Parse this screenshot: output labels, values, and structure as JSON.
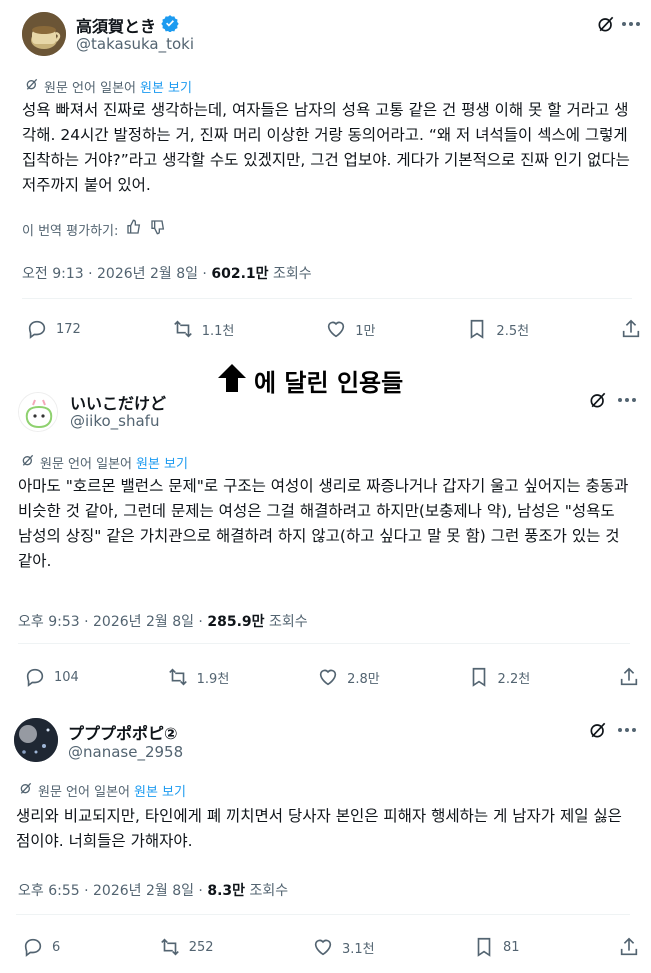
{
  "tweets": [
    {
      "name": "高須賀とき",
      "handle": "@takasuka_toki",
      "verified": true,
      "translation_note": "원문 언어 일본어",
      "show_original": "원본 보기",
      "text": "성욕 빠져서 진짜로 생각하는데, 여자들은 남자의 성욕 고통 같은 건 평생 이해 못 할 거라고 생각해. 24시간 발정하는 거, 진짜 머리 이상한 거랑 동의어라고. “왜 저 녀석들이 섹스에 그렇게 집착하는 거야?”라고 생각할 수도 있겠지만, 그건 업보야. 게다가 기본적으로 진짜 인기 없다는 저주까지 붙어 있어.",
      "rate_label": "이 번역 평가하기:",
      "time": "오전 9:13 · 2026년 2월 8일 ·",
      "views": "602.1만",
      "views_label": "조회수",
      "replies": "172",
      "retweets": "1.1천",
      "likes": "1만",
      "bookmarks": "2.5천"
    },
    {
      "name": "いいこだけど",
      "handle": "@iiko_shafu",
      "translation_note": "원문 언어 일본어",
      "show_original": "원본 보기",
      "text": "아마도 \"호르몬 밸런스 문제\"로 구조는 여성이 생리로 짜증나거나 갑자기 울고 싶어지는 충동과 비슷한 것 같아, 그런데 문제는 여성은 그걸 해결하려고 하지만(보충제나 약), 남성은 \"성욕도 남성의 상징\" 같은 가치관으로 해결하려 하지 않고(하고 싶다고 말 못 함) 그런 풍조가 있는 것 같아.",
      "time": "오후 9:53 · 2026년 2월 8일 ·",
      "views": "285.9만",
      "views_label": "조회수",
      "replies": "104",
      "retweets": "1.9천",
      "likes": "2.8만",
      "bookmarks": "2.2천"
    },
    {
      "name": "プププポポピ②",
      "handle": "@nanase_2958",
      "translation_note": "원문 언어 일본어",
      "show_original": "원본 보기",
      "text": "생리와 비교되지만, 타인에게 폐 끼치면서 당사자 본인은 피해자 행세하는 게 남자가 제일 싫은 점이야. 너희들은 가해자야.",
      "time": "오후 6:55 · 2026년 2월 8일 ·",
      "views": "8.3만",
      "views_label": "조회수",
      "replies": "6",
      "retweets": "252",
      "likes": "3.1천",
      "bookmarks": "81"
    }
  ],
  "quotes_banner": "에 달린 인용들",
  "colors": {
    "link": "#1d9bf0",
    "muted": "#536471",
    "text": "#0f1419"
  }
}
